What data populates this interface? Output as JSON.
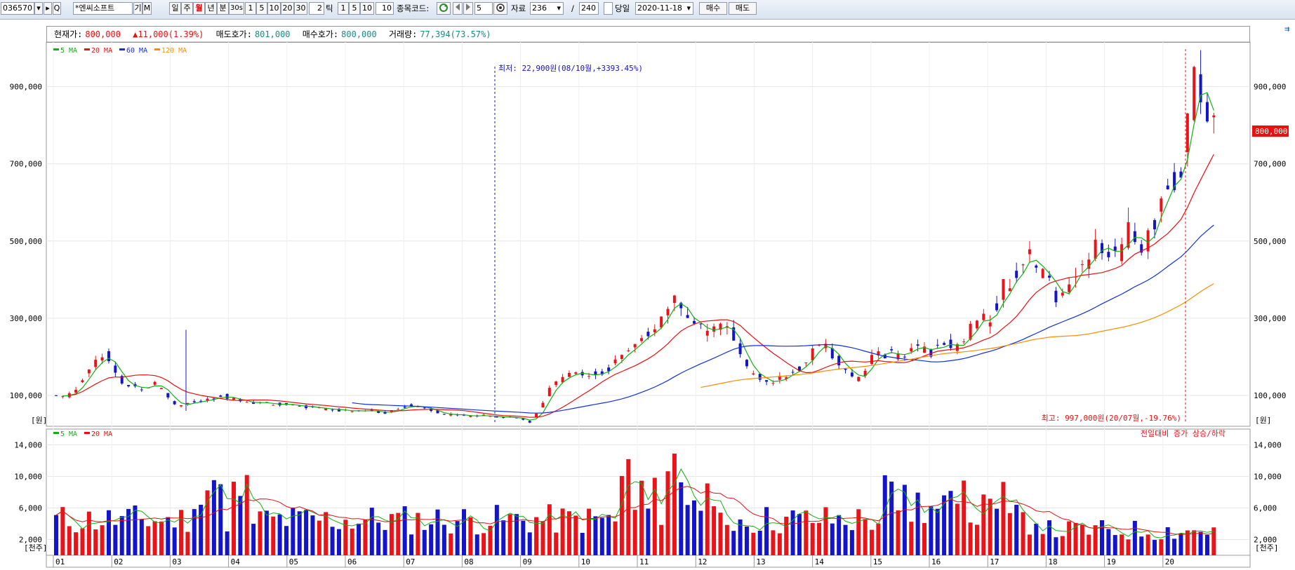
{
  "toolbar": {
    "code": "036570",
    "name": "*엔씨소프트",
    "btn_search": "Q",
    "btn_right": "▸",
    "btn_arrow": "▾",
    "btn_ki": "기",
    "btn_m": "M",
    "period_day": "일",
    "period_week": "주",
    "period_month": "월",
    "period_year": "년",
    "period_min": "분",
    "sec_label": "30s",
    "intervals": [
      "1",
      "5",
      "10",
      "20",
      "30"
    ],
    "tick_value": "2",
    "tick_label": "틱",
    "tick_buttons": [
      "1",
      "5",
      "10"
    ],
    "tick_count": "10",
    "code_label": "종목코드:",
    "nav_value": "5",
    "data_label": "자료",
    "data_count": "236",
    "slash": "/",
    "data_total": "240",
    "today_label": "당일",
    "date": "2020-11-18",
    "buy_label": "매수",
    "sell_label": "매도"
  },
  "info": {
    "price_label": "현재가:",
    "price": "800,000",
    "change": "▲11,000(1.39%)",
    "ask_label": "매도호가:",
    "ask": "801,000",
    "bid_label": "매수호가:",
    "bid": "800,000",
    "vol_label": "거래량:",
    "vol": "77,394(73.57%)"
  },
  "colors": {
    "up": "#e8141a",
    "down": "#1414c8",
    "ma5": "#12b012",
    "ma20": "#e81010",
    "ma60": "#1030e0",
    "ma120": "#ff8c00",
    "price_tag_bg": "#e81010"
  },
  "chart_data": [
    {
      "type": "candlestick",
      "legend": [
        {
          "name": "5 MA",
          "color": "#12b012"
        },
        {
          "name": "20 MA",
          "color": "#e81010"
        },
        {
          "name": "60 MA",
          "color": "#1030e0"
        },
        {
          "name": "120 MA",
          "color": "#ff8c00"
        }
      ],
      "y_ticks": [
        "100,000",
        "300,000",
        "500,000",
        "700,000",
        "900,000"
      ],
      "y_unit": "[원]",
      "ylim": [
        20000,
        1010000
      ],
      "current_price_tag": "800,000",
      "annotation_low": "최저: 22,900원(08/10월,+3393.45%)",
      "annotation_high": "최고: 997,000원(20/07월,-19.76%)",
      "series_note": "monthly candles 2001-2020, approx.",
      "candles_close_approx": [
        120000,
        90000,
        135000,
        210000,
        150000,
        90000,
        100000,
        70000,
        75000,
        80000,
        90000,
        95000,
        100000,
        85000,
        80000,
        75000,
        70000,
        55000,
        50000,
        45000,
        90000,
        130000,
        180000,
        220000,
        300000,
        330000,
        260000,
        200000,
        140000,
        150000,
        175000,
        230000,
        200000,
        190000,
        230000,
        300000,
        420000,
        370000,
        440000,
        500000,
        520000,
        620000,
        800000,
        800000
      ]
    },
    {
      "type": "bar",
      "legend": [
        {
          "name": "5 MA",
          "color": "#12b012"
        },
        {
          "name": "20 MA",
          "color": "#e81010"
        }
      ],
      "y_ticks": [
        "2,000",
        "6,000",
        "10,000",
        "14,000"
      ],
      "y_unit": "[천주]",
      "ylim": [
        0,
        16000
      ],
      "note_right": "전일대비 증가 상승/하락",
      "x_ticks": [
        "01",
        "02",
        "03",
        "04",
        "05",
        "06",
        "07",
        "08",
        "09",
        "10",
        "11",
        "12",
        "13",
        "14",
        "15",
        "16",
        "17",
        "18",
        "19",
        "20"
      ]
    }
  ]
}
